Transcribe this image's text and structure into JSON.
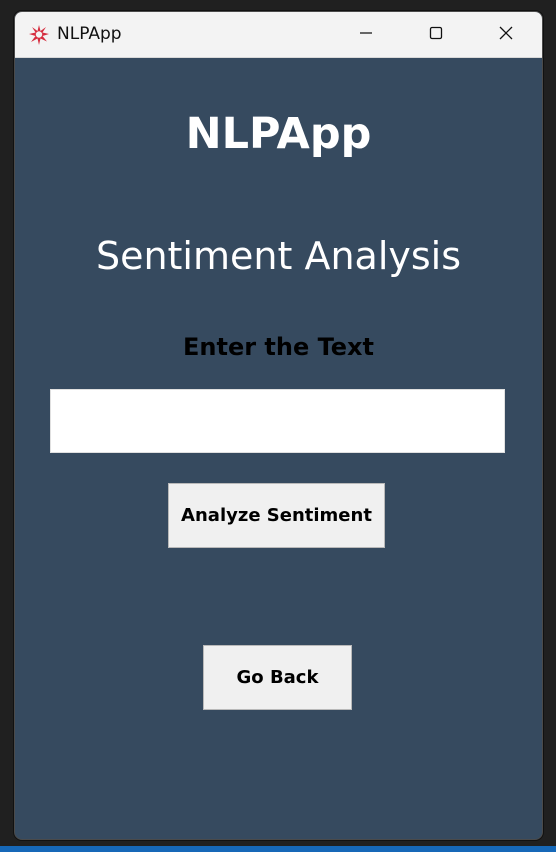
{
  "window": {
    "title": "NLPApp",
    "icon": "app-splat-icon",
    "controls": [
      "minimize-icon",
      "maximize-icon",
      "close-icon"
    ]
  },
  "main": {
    "app_title": "NLPApp",
    "section_title": "Sentiment Analysis",
    "input_label": "Enter the Text",
    "input_value": "",
    "analyze_button": "Analyze Sentiment",
    "back_button": "Go Back"
  },
  "colors": {
    "background": "#364a5f",
    "titlebar": "#f3f3f3",
    "button": "#f0f0f0",
    "icon_accent": "#d62d3f"
  }
}
